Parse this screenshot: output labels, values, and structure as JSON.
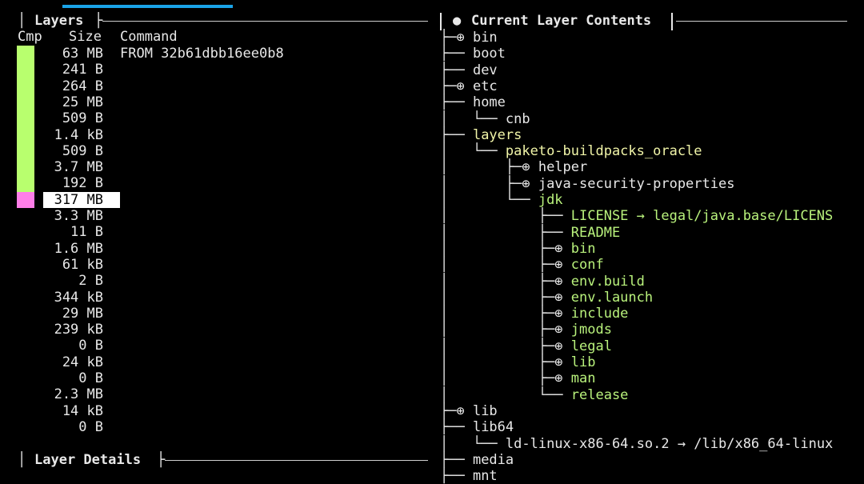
{
  "left_panel": {
    "title": "Layers",
    "headers": {
      "cmp": "Cmp",
      "size": "Size",
      "command": "Command"
    },
    "layers": [
      {
        "size": "63 MB",
        "command": "FROM 32b61dbb16ee0b8"
      },
      {
        "size": "241 B",
        "command": ""
      },
      {
        "size": "264 B",
        "command": ""
      },
      {
        "size": "25 MB",
        "command": ""
      },
      {
        "size": "509 B",
        "command": ""
      },
      {
        "size": "1.4 kB",
        "command": ""
      },
      {
        "size": "509 B",
        "command": ""
      },
      {
        "size": "3.7 MB",
        "command": ""
      },
      {
        "size": "192 B",
        "command": ""
      },
      {
        "size": "317 MB",
        "command": ""
      },
      {
        "size": "3.3 MB",
        "command": ""
      },
      {
        "size": "11 B",
        "command": ""
      },
      {
        "size": "1.6 MB",
        "command": ""
      },
      {
        "size": "61 kB",
        "command": ""
      },
      {
        "size": "2 B",
        "command": ""
      },
      {
        "size": "344 kB",
        "command": ""
      },
      {
        "size": "29 MB",
        "command": ""
      },
      {
        "size": "239 kB",
        "command": ""
      },
      {
        "size": "0 B",
        "command": ""
      },
      {
        "size": "24 kB",
        "command": ""
      },
      {
        "size": "0 B",
        "command": ""
      },
      {
        "size": "2.3 MB",
        "command": ""
      },
      {
        "size": "14 kB",
        "command": ""
      },
      {
        "size": "0 B",
        "command": ""
      }
    ],
    "details_title": "Layer Details",
    "colors": {
      "cmp_green": "#b8ff6e",
      "cmp_pink": "#ff7ee8",
      "selection": "#ffffff"
    }
  },
  "right_panel": {
    "title": "Current Layer Contents",
    "bullet": "●",
    "tree": [
      {
        "prefix": "├─⊕ ",
        "name": "bin",
        "color": "white"
      },
      {
        "prefix": "├── ",
        "name": "boot",
        "color": "white"
      },
      {
        "prefix": "├── ",
        "name": "dev",
        "color": "white"
      },
      {
        "prefix": "├─⊕ ",
        "name": "etc",
        "color": "white"
      },
      {
        "prefix": "├── ",
        "name": "home",
        "color": "white"
      },
      {
        "prefix": "│   └── ",
        "name": "cnb",
        "color": "white"
      },
      {
        "prefix": "├── ",
        "name": "layers",
        "color": "yellow"
      },
      {
        "prefix": "│   └── ",
        "name": "paketo-buildpacks_oracle",
        "color": "yellow"
      },
      {
        "prefix": "│       ├─⊕ ",
        "name": "helper",
        "color": "white"
      },
      {
        "prefix": "│       ├─⊕ ",
        "name": "java-security-properties",
        "color": "white"
      },
      {
        "prefix": "│       └── ",
        "name": "jdk",
        "color": "green"
      },
      {
        "prefix": "│           ├── ",
        "name": "LICENSE → legal/java.base/LICENS",
        "color": "green"
      },
      {
        "prefix": "│           ├── ",
        "name": "README",
        "color": "green"
      },
      {
        "prefix": "│           ├─⊕ ",
        "name": "bin",
        "color": "green"
      },
      {
        "prefix": "│           ├─⊕ ",
        "name": "conf",
        "color": "green"
      },
      {
        "prefix": "│           ├─⊕ ",
        "name": "env.build",
        "color": "green"
      },
      {
        "prefix": "│           ├─⊕ ",
        "name": "env.launch",
        "color": "green"
      },
      {
        "prefix": "│           ├─⊕ ",
        "name": "include",
        "color": "green"
      },
      {
        "prefix": "│           ├─⊕ ",
        "name": "jmods",
        "color": "green"
      },
      {
        "prefix": "│           ├─⊕ ",
        "name": "legal",
        "color": "green"
      },
      {
        "prefix": "│           ├─⊕ ",
        "name": "lib",
        "color": "green"
      },
      {
        "prefix": "│           ├─⊕ ",
        "name": "man",
        "color": "green"
      },
      {
        "prefix": "│           └── ",
        "name": "release",
        "color": "green"
      },
      {
        "prefix": "├─⊕ ",
        "name": "lib",
        "color": "white"
      },
      {
        "prefix": "├── ",
        "name": "lib64",
        "color": "white"
      },
      {
        "prefix": "│   └── ",
        "name": "ld-linux-x86-64.so.2 → /lib/x86_64-linux",
        "color": "white"
      },
      {
        "prefix": "├── ",
        "name": "media",
        "color": "white"
      },
      {
        "prefix": "├── ",
        "name": "mnt",
        "color": "white"
      }
    ],
    "colors": {
      "green": "#b9f27c",
      "yellow": "#f1f5a8",
      "white": "#e8e8e8"
    }
  },
  "accent": "#1aa3e8"
}
